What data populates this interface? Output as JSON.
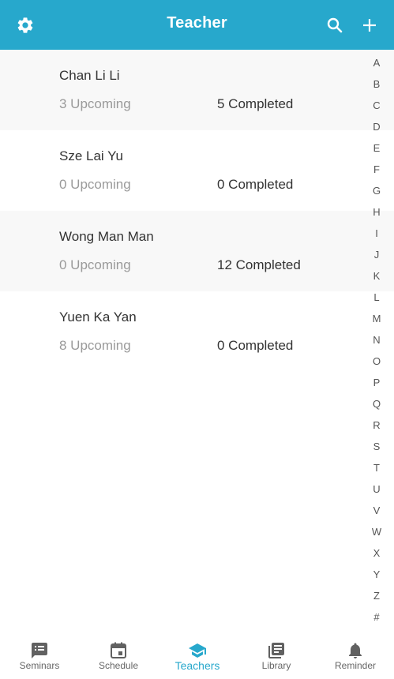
{
  "header": {
    "title": "Teacher",
    "icons": {
      "left": "gear-icon",
      "right": [
        "search-icon",
        "plus-icon"
      ]
    }
  },
  "teachers": [
    {
      "name": "Chan Li Li",
      "upcoming": "3 Upcoming",
      "completed": "5 Completed"
    },
    {
      "name": "Sze Lai Yu",
      "upcoming": "0 Upcoming",
      "completed": "0 Completed"
    },
    {
      "name": "Wong Man Man",
      "upcoming": "0 Upcoming",
      "completed": "12 Completed"
    },
    {
      "name": "Yuen Ka Yan",
      "upcoming": "8 Upcoming",
      "completed": "0 Completed"
    }
  ],
  "alphabet": [
    "A",
    "B",
    "C",
    "D",
    "E",
    "F",
    "G",
    "H",
    "I",
    "J",
    "K",
    "L",
    "M",
    "N",
    "O",
    "P",
    "Q",
    "R",
    "S",
    "T",
    "U",
    "V",
    "W",
    "X",
    "Y",
    "Z",
    "#"
  ],
  "tabs": [
    {
      "label": "Seminars",
      "icon": "seminars-icon"
    },
    {
      "label": "Schedule",
      "icon": "calendar-icon"
    },
    {
      "label": "Teachers",
      "icon": "graduation-cap-icon"
    },
    {
      "label": "Library",
      "icon": "library-icon"
    },
    {
      "label": "Reminder",
      "icon": "bell-icon"
    }
  ],
  "active_tab": "Teachers",
  "colors": {
    "accent": "#27a8cc",
    "alt_row": "#f8f8f8",
    "muted_text": "#9a9a9a"
  }
}
